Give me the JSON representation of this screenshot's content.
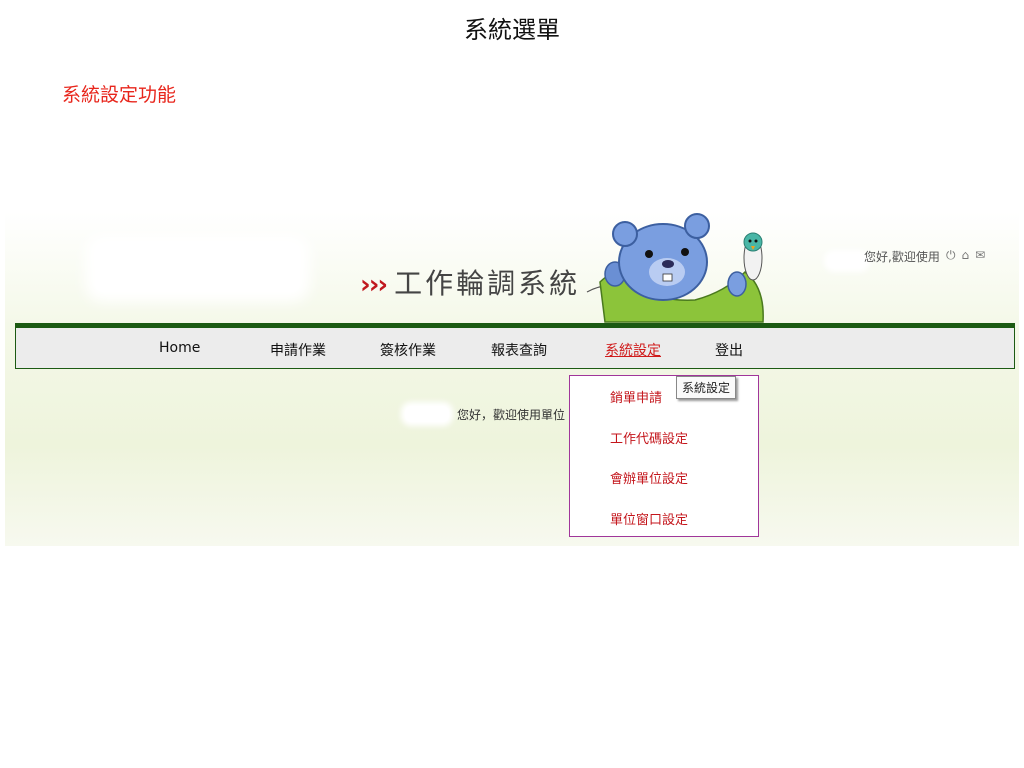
{
  "slide": {
    "title": "系統選單",
    "subtitle": "系統設定功能"
  },
  "app": {
    "banner_arrows": "›››",
    "banner_title": "工作輪調系統",
    "greeting": "您好,歡迎使用",
    "icons": [
      "power-icon",
      "home-icon",
      "mail-icon"
    ]
  },
  "nav": {
    "items": [
      {
        "label": "Home"
      },
      {
        "label": "申請作業"
      },
      {
        "label": "簽核作業"
      },
      {
        "label": "報表查詢"
      },
      {
        "label": "系統設定",
        "active": true
      },
      {
        "label": "登出"
      }
    ]
  },
  "dropdown": {
    "items": [
      {
        "label": "銷單申請"
      },
      {
        "label": "工作代碼設定"
      },
      {
        "label": "會辦單位設定"
      },
      {
        "label": "單位窗口設定"
      }
    ],
    "tooltip": "系統設定"
  },
  "main": {
    "welcome": "您好，歡迎使用單位"
  },
  "colors": {
    "nav_border": "#1c5a13",
    "accent_red": "#c4161c",
    "dropdown_border": "#a0369a"
  }
}
